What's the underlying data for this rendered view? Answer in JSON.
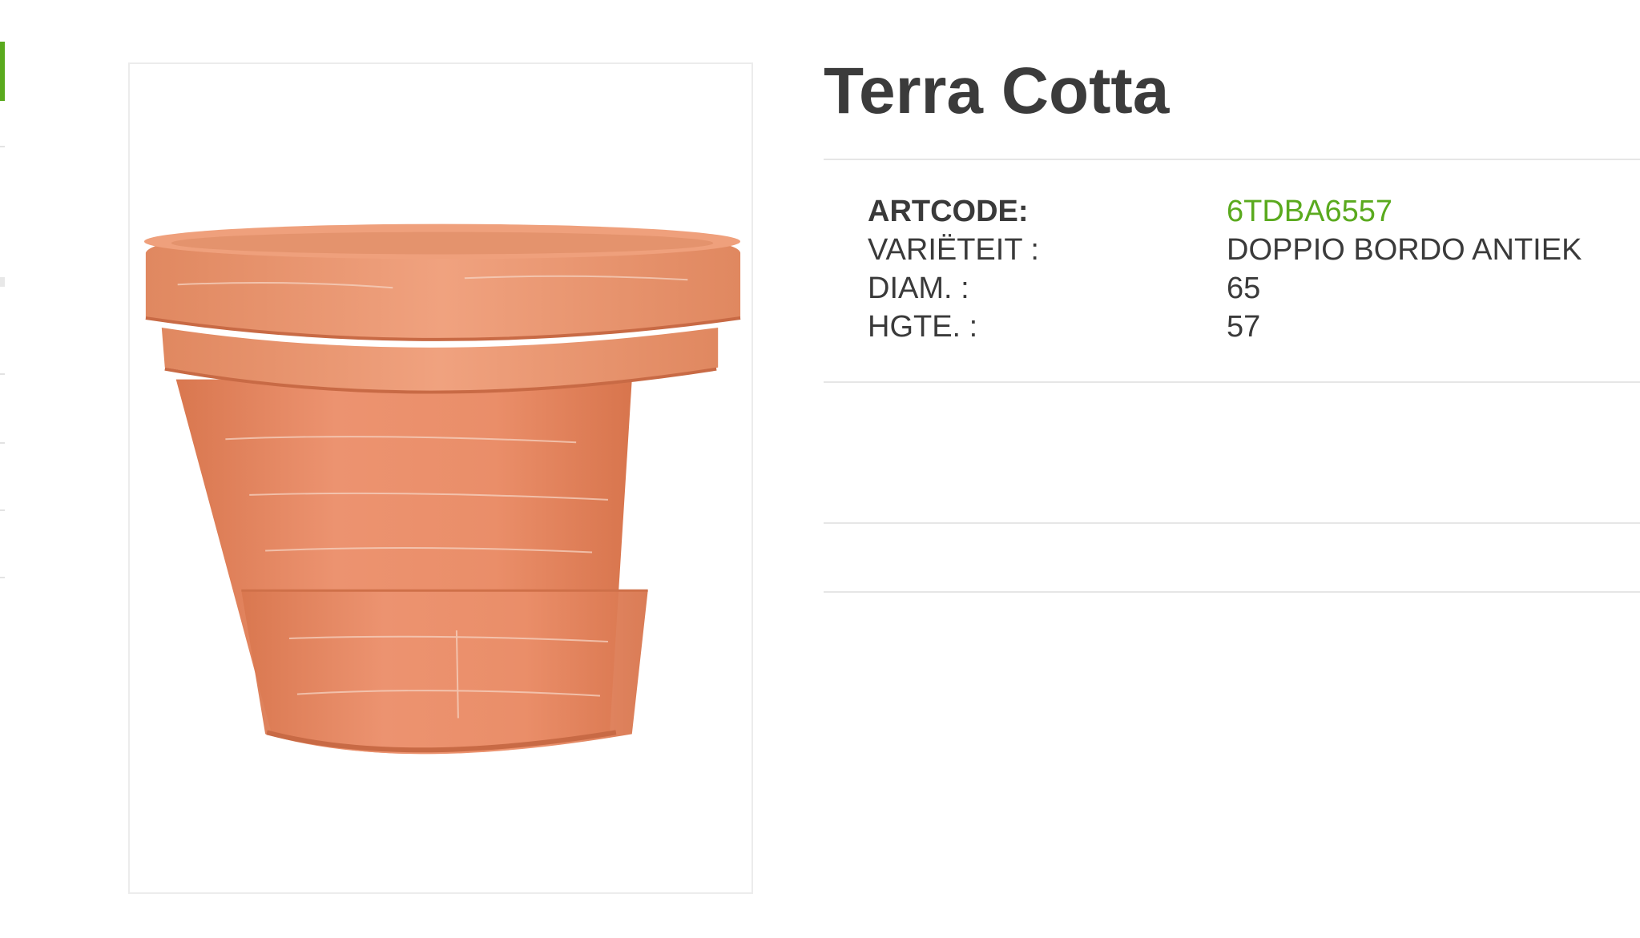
{
  "product": {
    "title": "Terra Cotta",
    "image_alt": "terracotta pot"
  },
  "specs": [
    {
      "label": "ARTCODE:",
      "value": "6TDBA6557"
    },
    {
      "label": "VARIËTEIT :",
      "value": "DOPPIO BORDO ANTIEK"
    },
    {
      "label": "DIAM. :",
      "value": "65"
    },
    {
      "label": "HGTE. :",
      "value": "57"
    }
  ],
  "colors": {
    "accent": "#5aaa1e",
    "text": "#3a3a3a",
    "divider": "#e6e6e6",
    "pot": "#e98f6b"
  }
}
